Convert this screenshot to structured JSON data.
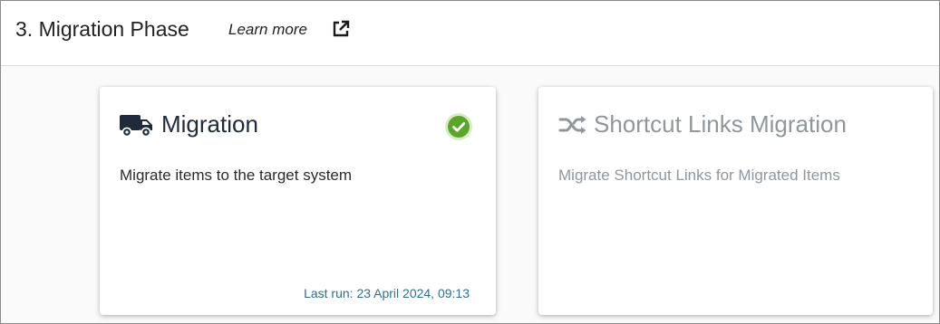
{
  "header": {
    "title": "3. Migration Phase",
    "learn_more": "Learn more",
    "external_link_icon": "external-link-icon"
  },
  "cards": [
    {
      "icon": "truck-icon",
      "title": "Migration",
      "description": "Migrate items to the target system",
      "status_icon": "check-circle-icon",
      "status_color": "#5aa52a",
      "last_run": "Last run: 23 April 2024, 09:13",
      "enabled": true
    },
    {
      "icon": "shuffle-icon",
      "title": "Shortcut Links Migration",
      "description": "Migrate Shortcut Links for Migrated Items",
      "enabled": false
    }
  ],
  "colors": {
    "title_text": "#1f2b3a",
    "disabled_text": "#8f969c",
    "link_text": "#2f6e8f",
    "success": "#5aa52a"
  }
}
